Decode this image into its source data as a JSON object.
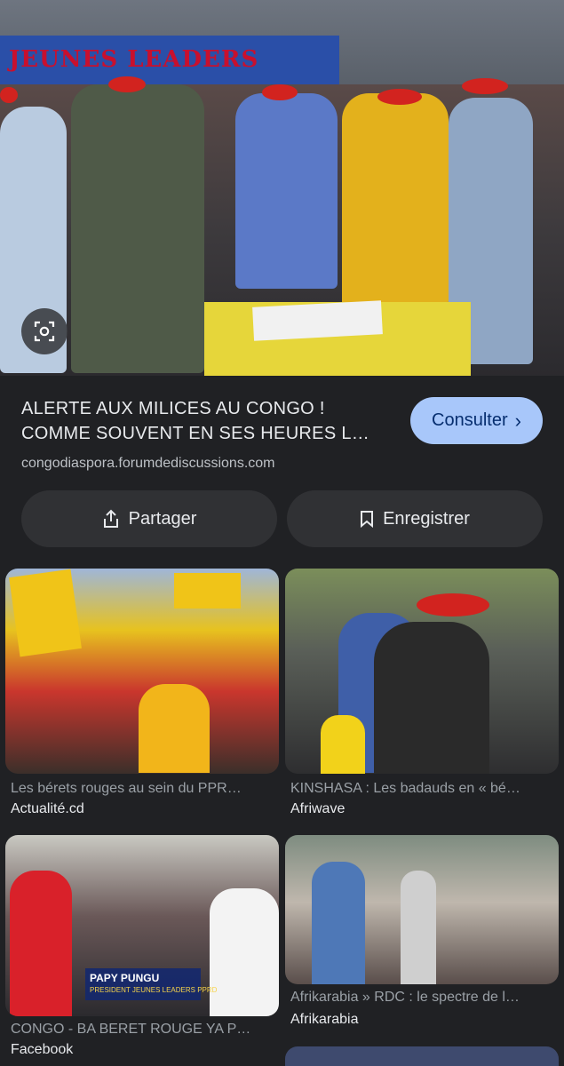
{
  "hero": {
    "banner_text": "JEUNES LEADERS",
    "alt": "Jeunes Leaders rally photo"
  },
  "buttons": {
    "more_icon": "•••",
    "close_icon": "✕"
  },
  "result": {
    "title": "ALERTE AUX MILICES AU CONGO ! COMME SOUVENT EN SES HEURES L…",
    "domain": "congodiaspora.forumdediscussions.com",
    "consult_label": "Consulter"
  },
  "actions": {
    "share_label": "Partager",
    "save_label": "Enregistrer"
  },
  "related": [
    {
      "caption": "Les bérets rouges au sein du PPR…",
      "source": "Actualité.cd"
    },
    {
      "caption": "KINSHASA : Les badauds en « bé…",
      "source": "Afriwave"
    },
    {
      "caption": "CONGO - BA BERET ROUGE YA P…",
      "source": "Facebook",
      "overlay_name": "PAPY PUNGU",
      "overlay_role": "PRESIDENT JEUNES LEADERS PPRD"
    },
    {
      "caption": "Afrikarabia » RDC : le spectre de l…",
      "source": "Afrikarabia"
    }
  ],
  "colors": {
    "background": "#202124",
    "accent_button": "#a8c7fa",
    "chip": "#303134"
  }
}
